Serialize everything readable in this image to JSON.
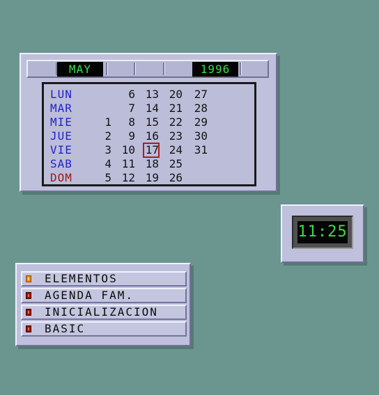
{
  "calendar": {
    "month": "MAY",
    "year": "1996",
    "rows": [
      {
        "day": "LUN",
        "dates": [
          "",
          "6",
          "13",
          "20",
          "27"
        ]
      },
      {
        "day": "MAR",
        "dates": [
          "",
          "7",
          "14",
          "21",
          "28"
        ]
      },
      {
        "day": "MIE",
        "dates": [
          "1",
          "8",
          "15",
          "22",
          "29"
        ]
      },
      {
        "day": "JUE",
        "dates": [
          "2",
          "9",
          "16",
          "23",
          "30"
        ]
      },
      {
        "day": "VIE",
        "dates": [
          "3",
          "10",
          "17",
          "24",
          "31"
        ]
      },
      {
        "day": "SAB",
        "dates": [
          "4",
          "11",
          "18",
          "25",
          ""
        ]
      },
      {
        "day": "DOM",
        "dates": [
          "5",
          "12",
          "19",
          "26",
          ""
        ]
      }
    ],
    "today": "17"
  },
  "clock": {
    "time": "11:25"
  },
  "menu": {
    "items": [
      {
        "label": "ELEMENTOS",
        "active": true
      },
      {
        "label": "AGENDA FAM.",
        "active": false
      },
      {
        "label": "INICIALIZACION",
        "active": false
      },
      {
        "label": "BASIC",
        "active": false
      }
    ]
  },
  "colors": {
    "desktop": "#6b9690",
    "panel": "#bfc0dc",
    "lcd_green": "#35e047",
    "weekday_blue": "#2222cc",
    "sunday_red": "#a01818"
  }
}
